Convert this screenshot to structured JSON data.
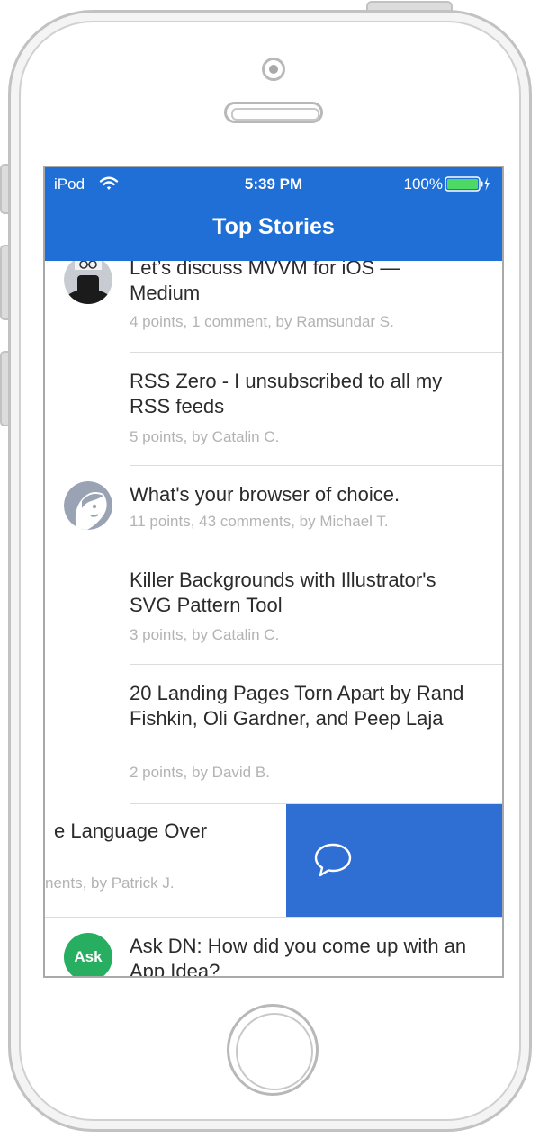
{
  "status_bar": {
    "carrier": "iPod",
    "time": "5:39 PM",
    "battery": "100%"
  },
  "header": {
    "title": "Top Stories"
  },
  "stories": [
    {
      "title": "Let’s discuss MVVM for iOS — Medium",
      "meta": "4 points, 1 comment, by Ramsundar S.",
      "avatar": "glasses-man-avatar"
    },
    {
      "title": "RSS Zero - I unsubscribed to all my RSS feeds",
      "meta": "5 points, by Catalin C.",
      "avatar": "none"
    },
    {
      "title": "What's your browser of choice.",
      "meta": "11 points, 43 comments, by Michael T.",
      "avatar": "default-person-avatar"
    },
    {
      "title": "Killer Backgrounds with Illustrator's SVG Pattern Tool",
      "meta": "3 points, by Catalin C.",
      "avatar": "none"
    },
    {
      "title": "20 Landing Pages Torn Apart by Rand Fishkin, Oli Gardner, and Peep Laja",
      "meta": "2 points, by David B.",
      "avatar": "none"
    }
  ],
  "swiped_story": {
    "title_fragment": "e Language Over",
    "meta_fragment": "nents, by Patrick J.",
    "action_icon": "comment-bubble-icon"
  },
  "last_story": {
    "avatar_label": "Ask",
    "title": "Ask DN: How did you come up with an App Idea?"
  },
  "colors": {
    "header": "#1f6fd6",
    "swipe_action": "#2f6fd4",
    "ask_badge": "#27ae60",
    "battery_fill": "#4cd964"
  }
}
